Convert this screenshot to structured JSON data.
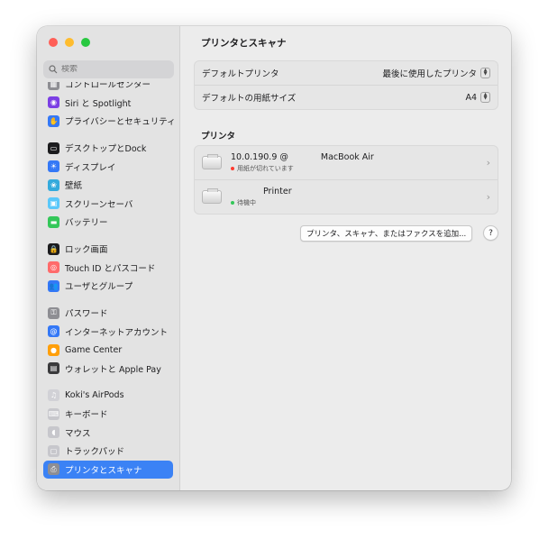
{
  "search": {
    "placeholder": "検索"
  },
  "sidebar": {
    "items": [
      {
        "label": "コントロールセンター",
        "icon": "control-center-icon",
        "color": "#8e8e93",
        "glyph": "▦"
      },
      {
        "label": "Siri と Spotlight",
        "icon": "siri-icon",
        "color": "#7b3fe4",
        "glyph": "◉"
      },
      {
        "label": "プライバシーとセキュリティ",
        "icon": "hand-icon",
        "color": "#3478f6",
        "glyph": "✋"
      },
      {
        "label": "デスクトップとDock",
        "icon": "dock-icon",
        "color": "#1c1c1e",
        "glyph": "▭"
      },
      {
        "label": "ディスプレイ",
        "icon": "display-icon",
        "color": "#3478f6",
        "glyph": "☀"
      },
      {
        "label": "壁紙",
        "icon": "wallpaper-icon",
        "color": "#34aadc",
        "glyph": "❀"
      },
      {
        "label": "スクリーンセーバ",
        "icon": "screensaver-icon",
        "color": "#5ac8fa",
        "glyph": "▣"
      },
      {
        "label": "バッテリー",
        "icon": "battery-icon",
        "color": "#34c759",
        "glyph": "▬"
      },
      {
        "label": "ロック画面",
        "icon": "lock-icon",
        "color": "#1c1c1e",
        "glyph": "🔒"
      },
      {
        "label": "Touch ID とパスコード",
        "icon": "fingerprint-icon",
        "color": "#ff6b6b",
        "glyph": "◎"
      },
      {
        "label": "ユーザとグループ",
        "icon": "users-icon",
        "color": "#3478f6",
        "glyph": "👥"
      },
      {
        "label": "パスワード",
        "icon": "key-icon",
        "color": "#8e8e93",
        "glyph": "⚿"
      },
      {
        "label": "インターネットアカウント",
        "icon": "at-icon",
        "color": "#3478f6",
        "glyph": "@"
      },
      {
        "label": "Game Center",
        "icon": "game-center-icon",
        "color": "#ff9f0a",
        "glyph": "●"
      },
      {
        "label": "ウォレットと Apple Pay",
        "icon": "wallet-icon",
        "color": "#3a3a3c",
        "glyph": "▤"
      },
      {
        "label": "Koki's AirPods",
        "icon": "airpods-icon",
        "color": "#d1d1d6",
        "glyph": "♫"
      },
      {
        "label": "キーボード",
        "icon": "keyboard-icon",
        "color": "#c7c7cc",
        "glyph": "⌨"
      },
      {
        "label": "マウス",
        "icon": "mouse-icon",
        "color": "#c7c7cc",
        "glyph": "◖"
      },
      {
        "label": "トラックパッド",
        "icon": "trackpad-icon",
        "color": "#c7c7cc",
        "glyph": "▢"
      },
      {
        "label": "プリンタとスキャナ",
        "icon": "printer-icon",
        "color": "#8e8e93",
        "glyph": "⎙"
      }
    ]
  },
  "main": {
    "title": "プリンタとスキャナ",
    "settings": [
      {
        "label": "デフォルトプリンタ",
        "value": "最後に使用したプリンタ"
      },
      {
        "label": "デフォルトの用紙サイズ",
        "value": "A4"
      }
    ],
    "printers_title": "プリンタ",
    "printers": [
      {
        "name_prefix": "10.0.190.9 @",
        "name_suffix": "MacBook Air",
        "status": "用紙が切れています",
        "status_color": "#ff3b30"
      },
      {
        "name_prefix": "",
        "name_suffix": "Printer",
        "status": "待機中",
        "status_color": "#34c759"
      }
    ],
    "add_button": "プリンタ、スキャナ、またはファクスを追加...",
    "help_label": "?"
  }
}
